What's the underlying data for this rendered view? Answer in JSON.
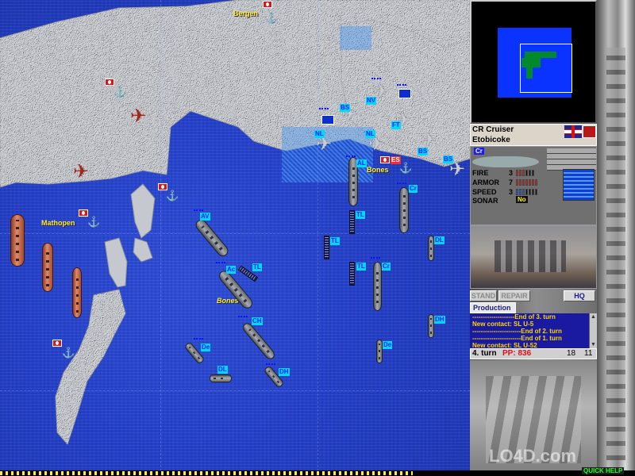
{
  "map": {
    "places": [
      {
        "name": "Bergen"
      },
      {
        "name": "Mathopen"
      },
      {
        "name": "Bones"
      },
      {
        "name": "Bones"
      }
    ],
    "unit_labels": [
      "AV",
      "Ac",
      "CH",
      "TL",
      "TL",
      "TL",
      "TL",
      "TL",
      "De",
      "DL",
      "DH",
      "Cr",
      "Cr",
      "DL",
      "DH",
      "De",
      "BS",
      "BS",
      "NL",
      "NL",
      "NV",
      "FT",
      "BS",
      "AL",
      "ES"
    ]
  },
  "panel": {
    "unit": {
      "type": "CR   Cruiser",
      "name": "Etobicoke",
      "class_tag": "Cr",
      "stats": [
        {
          "label": "FIRE",
          "value": "3",
          "level": 3,
          "max": 6
        },
        {
          "label": "ARMOR",
          "value": "7",
          "level": 7,
          "max": 7
        },
        {
          "label": "SPEED",
          "value": "3",
          "level": 3,
          "max": 7
        },
        {
          "label": "SONAR",
          "value": "No"
        }
      ]
    },
    "buttons": {
      "stand": "STAND",
      "repair": "REPAIR",
      "hq": "HQ"
    },
    "production_tab": "Production",
    "log": [
      "--------------------End of 3. turn",
      "New contact: SL U-5",
      "-----------------------End of 2. turn",
      "-----------------------End of 1. turn",
      "New contact: SL U-52"
    ],
    "status": {
      "turn": "4. turn",
      "pp": "PP: 836",
      "n1": "18",
      "n2": "11"
    }
  },
  "bottom": {
    "quick_help": "QUICK HELP"
  },
  "watermark": "LO4D.com",
  "colors": {
    "sea": "#2440c8",
    "land": "#c8ccd2",
    "label_text": "#ffee33",
    "unit_tag": "#00d8ff",
    "log_bg": "#1a1aa0",
    "pp": "#e01010"
  }
}
